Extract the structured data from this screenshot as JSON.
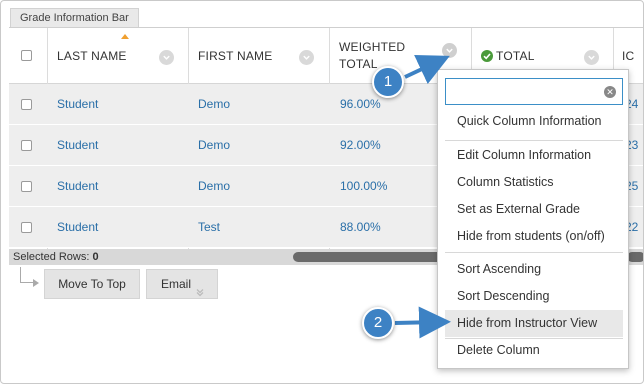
{
  "grade_info_bar": {
    "label": "Grade Information Bar"
  },
  "columns": {
    "last_name": "LAST NAME",
    "first_name": "FIRST NAME",
    "weighted_total_line1": "WEIGHTED",
    "weighted_total_line2": "TOTAL",
    "total": "TOTAL",
    "partial": "IC"
  },
  "rows": [
    {
      "last": "Student",
      "first": "Demo",
      "weighted": "96.00%",
      "partial": "24"
    },
    {
      "last": "Student",
      "first": "Demo",
      "weighted": "92.00%",
      "partial": "23"
    },
    {
      "last": "Student",
      "first": "Demo",
      "weighted": "100.00%",
      "partial": "25"
    },
    {
      "last": "Student",
      "first": "Test",
      "weighted": "88.00%",
      "partial": "22"
    }
  ],
  "footer": {
    "selected_label": "Selected Rows:",
    "selected_count": "0",
    "move_to_top": "Move To Top",
    "email": "Email"
  },
  "menu": {
    "search_value": "",
    "items": [
      "Quick Column Information",
      "Edit Column Information",
      "Column Statistics",
      "Set as External Grade",
      "Hide from students (on/off)",
      "Sort Ascending",
      "Sort Descending",
      "Hide from Instructor View",
      "Delete Column"
    ]
  },
  "callouts": {
    "one": "1",
    "two": "2"
  },
  "colors": {
    "link": "#2a6fa8",
    "callout": "#3d82c4",
    "status_ok": "#4a9a3a"
  }
}
